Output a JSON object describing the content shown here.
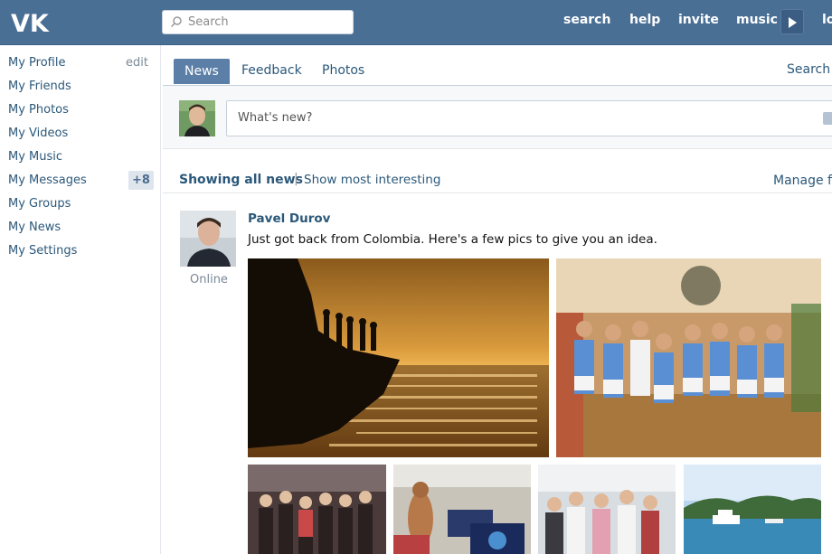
{
  "header": {
    "logo_text": "VK",
    "search_placeholder": "Search",
    "nav": [
      "search",
      "help",
      "invite",
      "music"
    ],
    "nav_cut": "lo"
  },
  "sidebar": {
    "items": [
      {
        "label": "My Profile"
      },
      {
        "label": "My Friends"
      },
      {
        "label": "My Photos"
      },
      {
        "label": "My Videos"
      },
      {
        "label": "My Music"
      },
      {
        "label": "My Messages"
      },
      {
        "label": "My Groups"
      },
      {
        "label": "My News"
      },
      {
        "label": "My Settings"
      }
    ],
    "edit_label": "edit",
    "messages_badge": "+8"
  },
  "tabs": {
    "items": [
      "News",
      "Feedback",
      "Photos"
    ],
    "active": "News",
    "search_label": "Search n"
  },
  "composer": {
    "placeholder": "What's new?"
  },
  "filters": {
    "all": "Showing all news",
    "separator": "|",
    "interesting": "Show most interesting",
    "manage": "Manage filt"
  },
  "post": {
    "author": "Pavel Durov",
    "status": "Online",
    "text": "Just got back from Colombia. Here's a few pics to give you an idea."
  },
  "colors": {
    "header_bg": "#4a6f95",
    "link": "#2b587a",
    "active_tab": "#5b7fa6"
  }
}
